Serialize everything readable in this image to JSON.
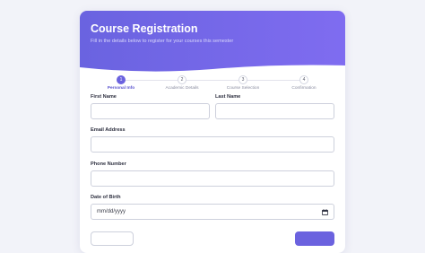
{
  "header": {
    "title": "Course Registration",
    "subtitle": "Fill in the details below to register for your courses this semester"
  },
  "steps": [
    {
      "number": "1",
      "label": "Personal Info",
      "active": true
    },
    {
      "number": "2",
      "label": "Academic Details",
      "active": false
    },
    {
      "number": "3",
      "label": "Course Selection",
      "active": false
    },
    {
      "number": "4",
      "label": "Confirmation",
      "active": false
    }
  ],
  "form": {
    "first_name_label": "First Name",
    "first_name_value": "",
    "last_name_label": "Last Name",
    "last_name_value": "",
    "email_label": "Email Address",
    "email_value": "",
    "phone_label": "Phone Number",
    "phone_value": "",
    "dob_label": "Date of Birth",
    "dob_placeholder": "mm/dd/yyyy"
  },
  "colors": {
    "accent": "#6b62df",
    "header_gradient_start": "#6a63e0",
    "header_gradient_end": "#7f6cf0"
  },
  "icons": {
    "dob_picker": "calendar-icon"
  }
}
